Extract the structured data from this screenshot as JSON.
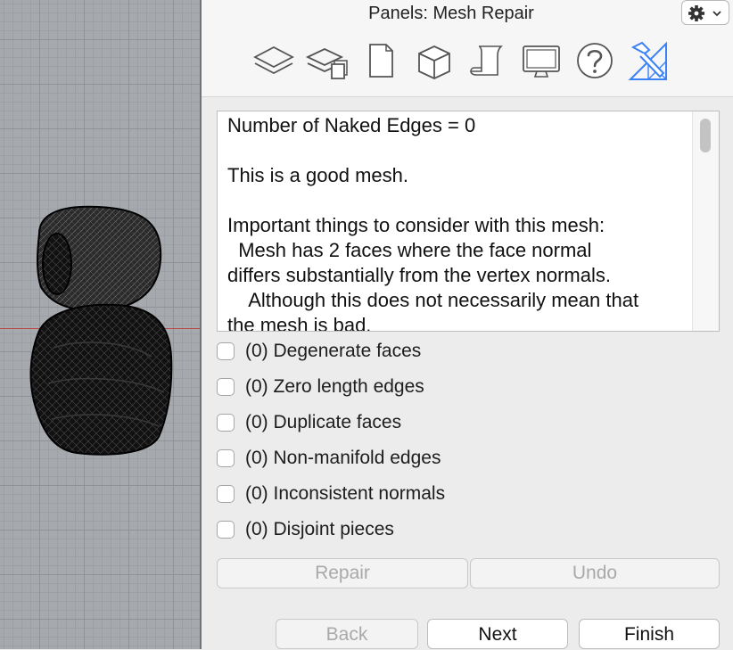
{
  "viewport": {
    "name": "3D viewport with wireframe mesh"
  },
  "panel": {
    "title": "Panels: Mesh Repair",
    "toolbar": [
      {
        "icon": "layers-icon",
        "active": false
      },
      {
        "icon": "layer-stack-icon",
        "active": false
      },
      {
        "icon": "document-icon",
        "active": false
      },
      {
        "icon": "cube-icon",
        "active": false
      },
      {
        "icon": "script-icon",
        "active": false
      },
      {
        "icon": "display-icon",
        "active": false
      },
      {
        "icon": "help-icon",
        "active": false
      },
      {
        "icon": "mesh-repair-icon",
        "active": true
      }
    ],
    "report_text": "Number of Naked Edges = 0\n\nThis is a good mesh.\n\nImportant things to consider with this mesh:\n  Mesh has 2 faces where the face normal\ndiffers substantially from the vertex normals.\n    Although this does not necessarily mean that\nthe mesh is bad.",
    "checks": [
      {
        "label": "(0) Degenerate faces",
        "checked": false
      },
      {
        "label": "(0) Zero length edges",
        "checked": false
      },
      {
        "label": "(0) Duplicate faces",
        "checked": false
      },
      {
        "label": "(0) Non-manifold edges",
        "checked": false
      },
      {
        "label": "(0) Inconsistent normals",
        "checked": false
      },
      {
        "label": "(0) Disjoint pieces",
        "checked": false
      }
    ],
    "buttons": {
      "repair": "Repair",
      "undo": "Undo",
      "back": "Back",
      "next": "Next",
      "finish": "Finish"
    }
  },
  "colors": {
    "accent": "#3b82f6",
    "axis": "#b94a43"
  }
}
